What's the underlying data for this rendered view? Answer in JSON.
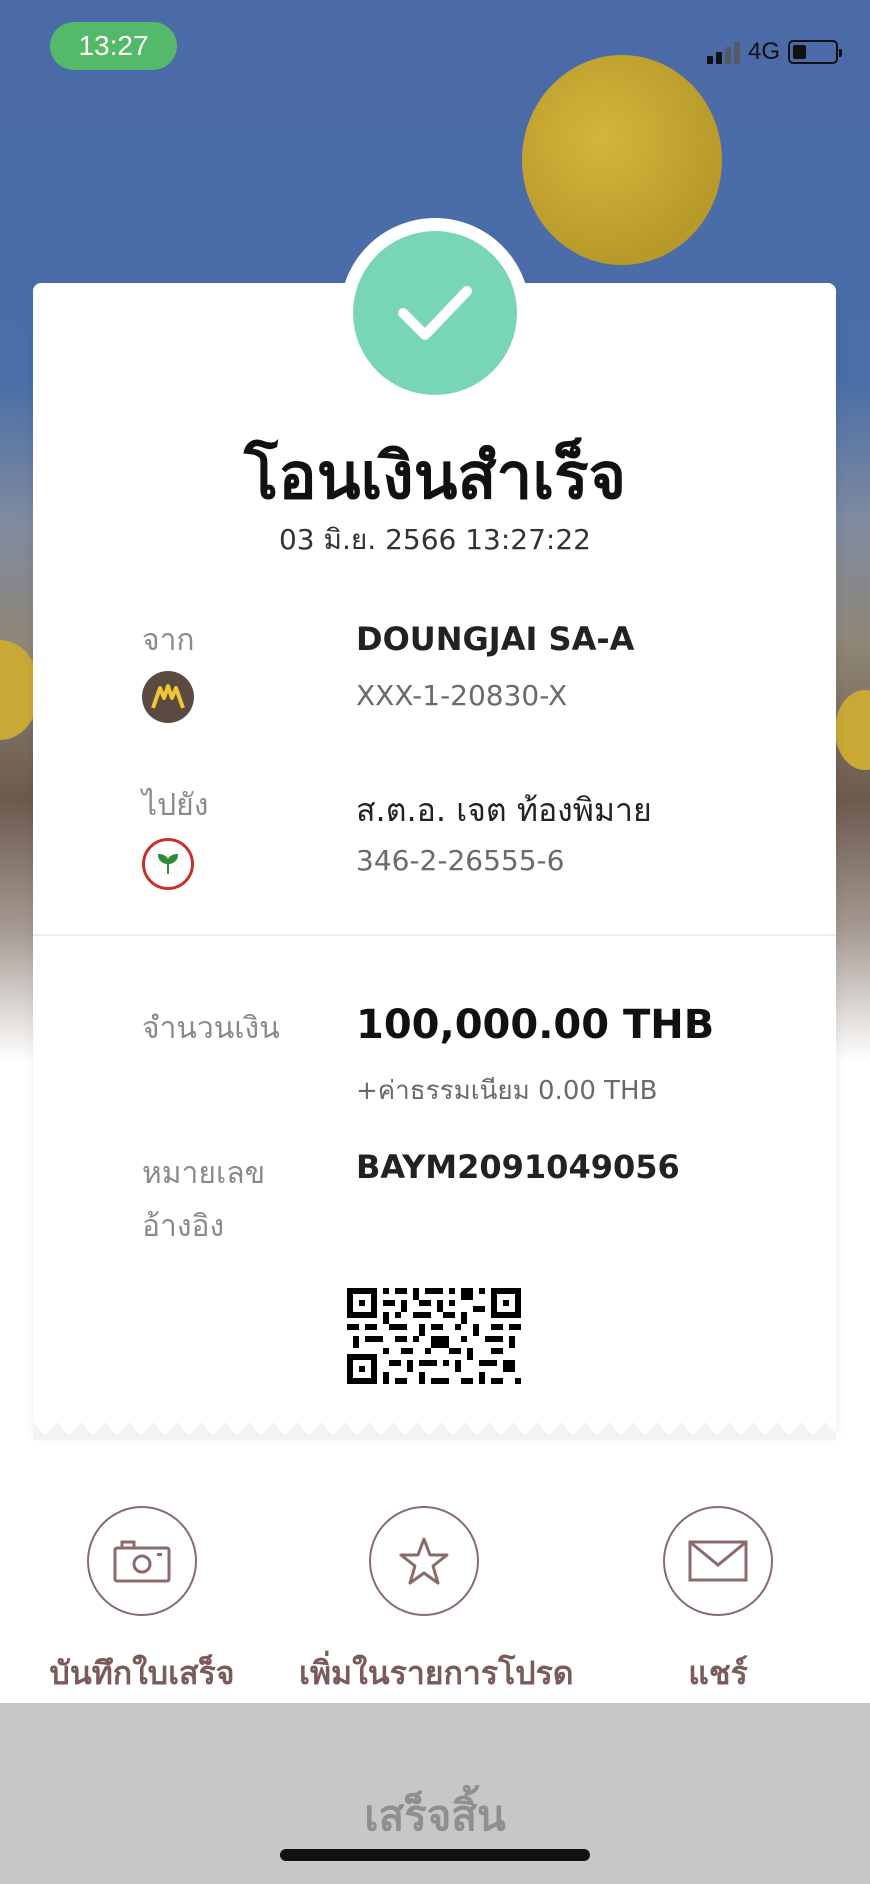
{
  "status_bar": {
    "time": "13:27",
    "network": "4G"
  },
  "receipt": {
    "title": "โอนเงินสำเร็จ",
    "datetime": "03 มิ.ย. 2566 13:27:22",
    "from": {
      "label": "จาก",
      "name": "DOUNGJAI SA-A",
      "account": "XXX-1-20830-X",
      "bank_icon": "krungsri-bank-icon"
    },
    "to": {
      "label": "ไปยัง",
      "name": "ส.ต.อ. เจต ท้องพิมาย",
      "account": "346-2-26555-6",
      "bank_icon": "kasikorn-bank-icon"
    },
    "amount": {
      "label": "จำนวนเงิน",
      "value": "100,000.00 THB",
      "fee": "+ค่าธรรมเนียม 0.00 THB"
    },
    "reference": {
      "label_line1": "หมายเลข",
      "label_line2": "อ้างอิง",
      "value": "BAYM2091049056"
    }
  },
  "actions": [
    {
      "label": "บันทึกใบเสร็จ",
      "icon": "camera-icon"
    },
    {
      "label": "เพิ่มในรายการโปรด",
      "icon": "star-icon"
    },
    {
      "label": "แชร์",
      "icon": "mail-icon"
    }
  ],
  "footer": {
    "done_label": "เสร็จสิ้น"
  },
  "colors": {
    "success": "#78d6b5",
    "action": "#7b5a5a",
    "time_pill": "#55b96a"
  }
}
